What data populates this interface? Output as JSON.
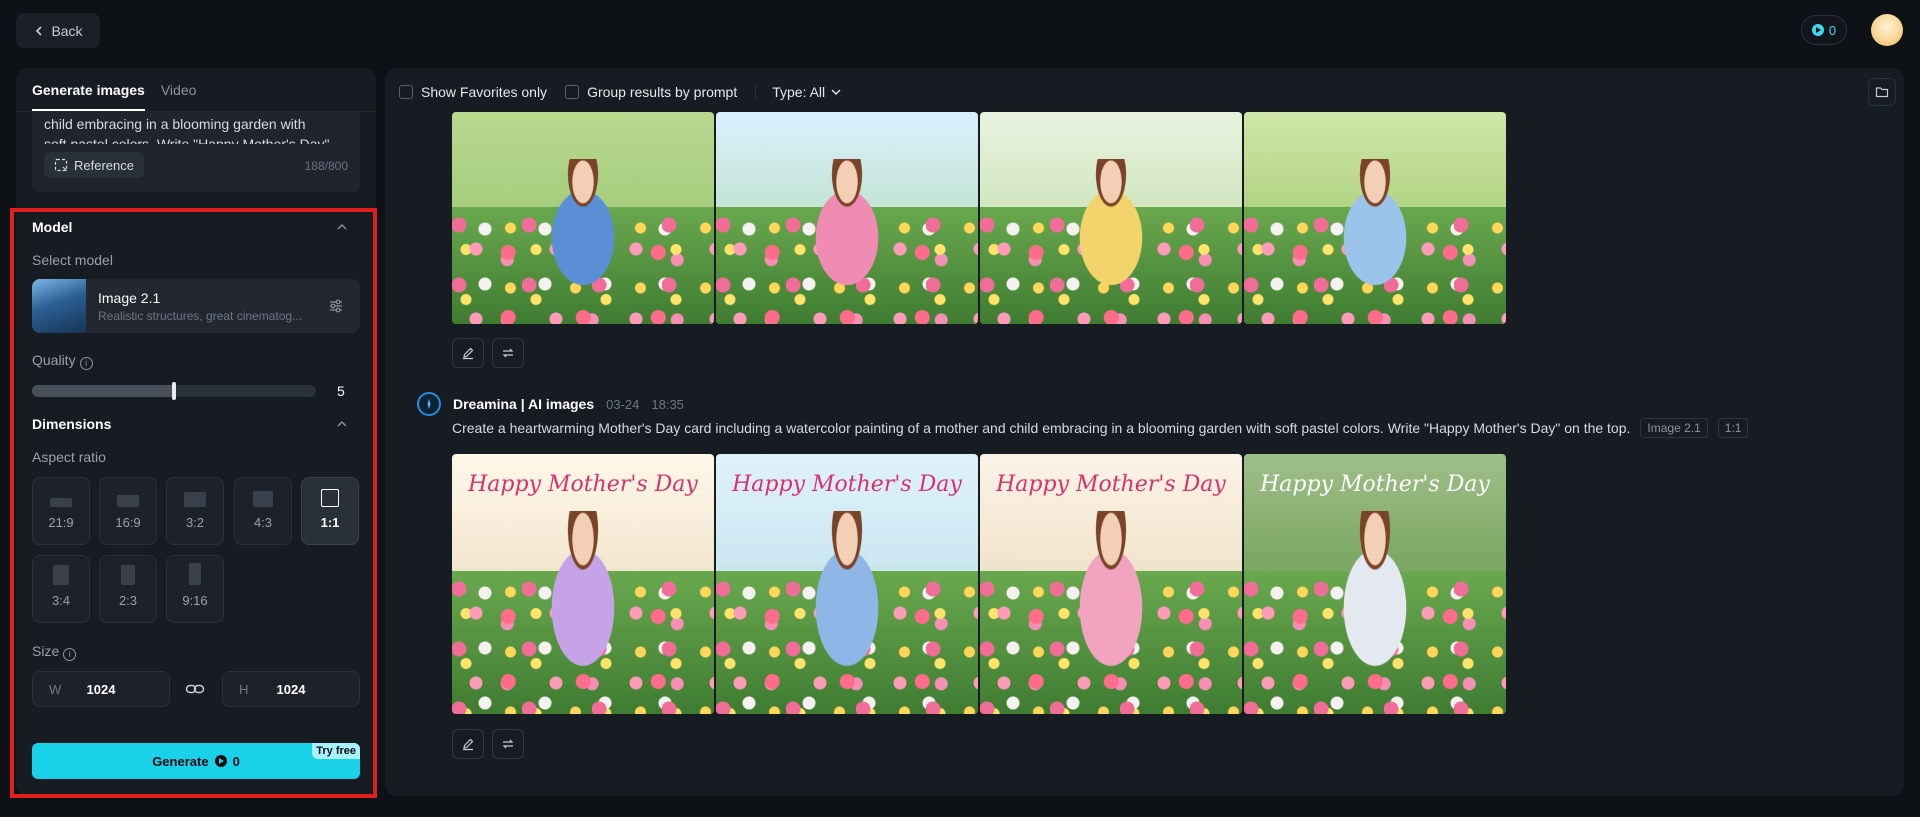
{
  "topbar": {
    "back_label": "Back",
    "credits": "0"
  },
  "left_panel": {
    "tabs": [
      {
        "label": "Generate images",
        "active": true
      },
      {
        "label": "Video",
        "active": false
      }
    ],
    "prompt_text": "child embracing in a blooming garden with soft pastel colors. Write \"Happy Mother's Day\" on",
    "reference_label": "Reference",
    "char_count": "188/800",
    "model_section": {
      "title": "Model",
      "select_label": "Select model",
      "model_name": "Image 2.1",
      "model_desc": "Realistic structures, great cinematog..."
    },
    "quality": {
      "label": "Quality",
      "value": "5",
      "fraction": 0.5
    },
    "dimensions": {
      "title": "Dimensions",
      "aspect_label": "Aspect ratio",
      "ratios": [
        "21:9",
        "16:9",
        "3:2",
        "4:3",
        "1:1",
        "3:4",
        "2:3",
        "9:16"
      ],
      "selected_ratio": "1:1",
      "size_label": "Size",
      "width_prefix": "W",
      "width": "1024",
      "height_prefix": "H",
      "height": "1024"
    },
    "generate": {
      "label": "Generate",
      "cost": "0",
      "badge": "Try free"
    }
  },
  "main": {
    "toolbar": {
      "favorites_label": "Show Favorites only",
      "group_label": "Group results by prompt",
      "type_label": "Type: All"
    },
    "generation": {
      "author": "Dreamina | AI images",
      "date": "03-24",
      "time": "18:35",
      "prompt": "Create a heartwarming Mother's Day card including a watercolor painting of a mother and child embracing in a blooming garden with soft pastel colors. Write \"Happy Mother's Day\" on the top.",
      "model_tag": "Image 2.1",
      "ratio_tag": "1:1",
      "card_titles": [
        "Happy Mother's Day",
        "Happy Mother's Day",
        "Happy Mother's Day",
        "Happy Mother's Day"
      ]
    }
  },
  "colors": {
    "accent": "#1ad1ea",
    "highlight_frame": "#e02020"
  }
}
